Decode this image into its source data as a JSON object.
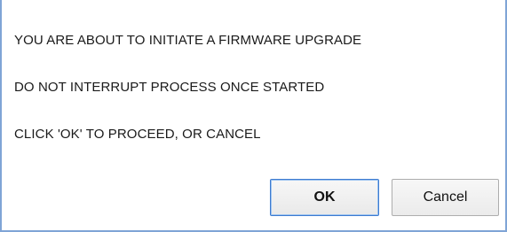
{
  "dialog": {
    "messages": [
      "YOU ARE ABOUT TO INITIATE A FIRMWARE UPGRADE",
      "DO NOT INTERRUPT PROCESS ONCE STARTED",
      "CLICK 'OK' TO PROCEED, OR CANCEL"
    ],
    "ok_label": "OK",
    "cancel_label": "Cancel",
    "accent_color": "#3d7bd0",
    "frame_color": "#7fa4d6"
  }
}
